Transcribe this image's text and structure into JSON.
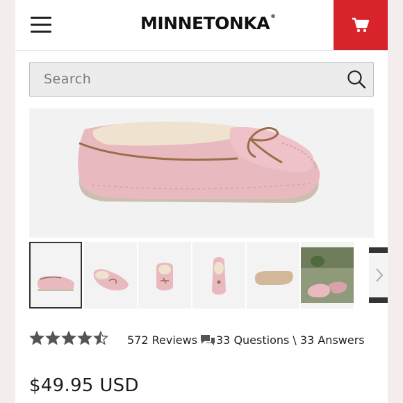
{
  "header": {
    "brand": "MINNETONKA",
    "brand_mark": "®",
    "menu_icon": "hamburger-menu-icon",
    "cart_icon": "shopping-cart-icon",
    "cart_color": "#d8232a"
  },
  "search": {
    "placeholder": "Search",
    "value": "",
    "icon": "search-icon"
  },
  "product": {
    "main_image": "pink suede moccasin slipper with fur lining, side view",
    "thumbnails": [
      {
        "label": "side view",
        "selected": true
      },
      {
        "label": "angled view",
        "selected": false
      },
      {
        "label": "top front view",
        "selected": false
      },
      {
        "label": "top view",
        "selected": false
      },
      {
        "label": "sole view",
        "selected": false
      },
      {
        "label": "lifestyle photo",
        "selected": false
      }
    ],
    "thumbnail_next_icon": "chevron-right-icon",
    "rating": 4.5,
    "review_count": "572 Reviews",
    "qa_icon": "chat-bubbles-icon",
    "qa_text": "33 Questions \\ 33 Answers",
    "price": "$49.95 USD"
  },
  "colors": {
    "star": "#555555",
    "shoe": "#e7b9be",
    "lace": "#9b6d4a"
  }
}
